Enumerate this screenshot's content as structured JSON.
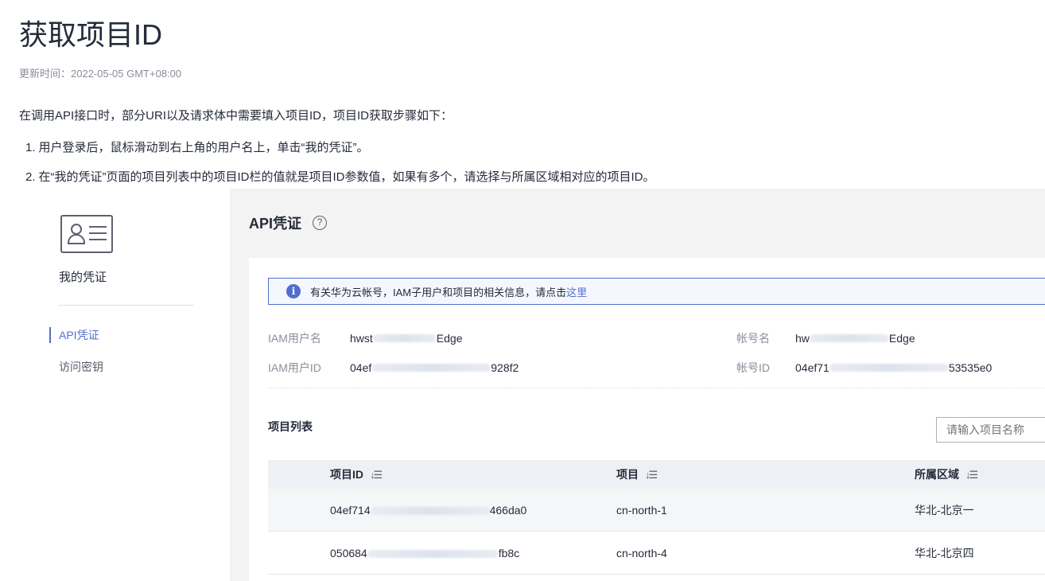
{
  "doc": {
    "title": "获取项目ID",
    "update_time": "更新时间：2022-05-05 GMT+08:00",
    "intro": "在调用API接口时，部分URI以及请求体中需要填入项目ID，项目ID获取步骤如下：",
    "steps": [
      {
        "num": "1.",
        "text": "用户登录后，鼠标滑动到右上角的用户名上，单击“我的凭证”。"
      },
      {
        "num": "2.",
        "text": "在“我的凭证”页面的项目列表中的项目ID栏的值就是项目ID参数值，如果有多个，请选择与所属区域相对应的项目ID。"
      }
    ]
  },
  "console": {
    "sidebar": {
      "icon": "id-card-icon",
      "title": "我的凭证",
      "items": [
        {
          "label": "API凭证",
          "active": true
        },
        {
          "label": "访问密钥",
          "active": false
        }
      ]
    },
    "header": {
      "title": "API凭证",
      "help_icon": "?"
    },
    "info": {
      "icon": "info-icon",
      "text": "有关华为云帐号，IAM子用户和项目的相关信息，请点击",
      "link": "这里"
    },
    "fields": {
      "iam_user_name": {
        "label": "IAM用户名",
        "prefix": "hwst",
        "suffix": "Edge"
      },
      "iam_user_id": {
        "label": "IAM用户ID",
        "prefix": "04ef",
        "suffix": "928f2"
      },
      "account_name": {
        "label": "帐号名",
        "prefix": "hw",
        "suffix": "Edge"
      },
      "account_id": {
        "label": "帐号ID",
        "prefix": "04ef71",
        "suffix": "53535e0"
      }
    },
    "projects": {
      "title": "项目列表",
      "search_placeholder": "请输入项目名称",
      "columns": [
        "项目ID",
        "项目",
        "所属区域"
      ],
      "sort_icon": "↓☰",
      "rows": [
        {
          "id_prefix": "04ef714",
          "id_suffix": "466da0",
          "project": "cn-north-1",
          "region": "华北-北京一"
        },
        {
          "id_prefix": "050684",
          "id_suffix": "fb8c",
          "project": "cn-north-4",
          "region": "华北-北京四"
        }
      ]
    }
  }
}
